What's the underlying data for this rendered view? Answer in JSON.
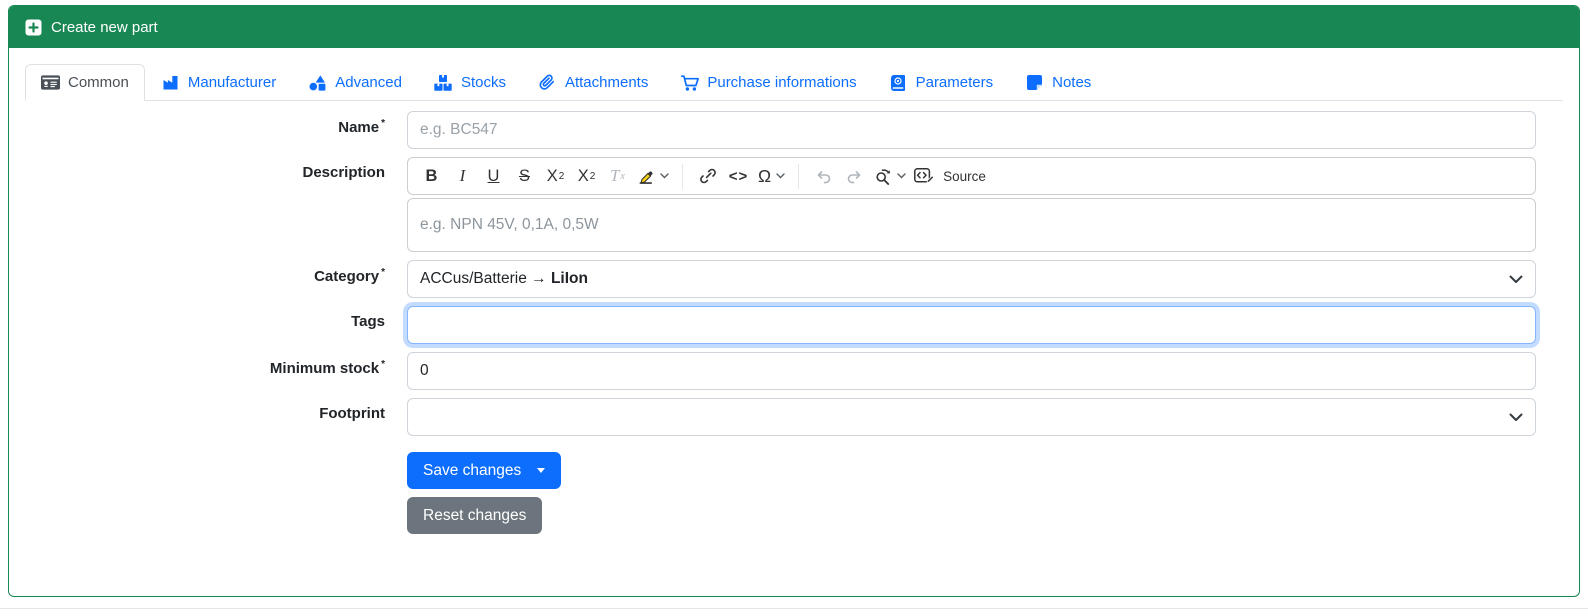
{
  "header": {
    "title": "Create new part"
  },
  "tabs": [
    {
      "label": "Common",
      "active": true
    },
    {
      "label": "Manufacturer"
    },
    {
      "label": "Advanced"
    },
    {
      "label": "Stocks"
    },
    {
      "label": "Attachments"
    },
    {
      "label": "Purchase informations"
    },
    {
      "label": "Parameters"
    },
    {
      "label": "Notes"
    }
  ],
  "form": {
    "name": {
      "label": "Name",
      "required": "*",
      "placeholder": "e.g. BC547",
      "value": ""
    },
    "description": {
      "label": "Description",
      "placeholder": "e.g. NPN 45V, 0,1A, 0,5W"
    },
    "category": {
      "label": "Category",
      "required": "*",
      "value_prefix": "ACCus/Batterie → ",
      "value_selected": "LiIon"
    },
    "tags": {
      "label": "Tags",
      "value": ""
    },
    "minimum_stock": {
      "label": "Minimum stock",
      "required": "*",
      "value": "0"
    },
    "footprint": {
      "label": "Footprint",
      "value": ""
    }
  },
  "editor_toolbar": {
    "bold": "B",
    "italic": "I",
    "underline": "U",
    "strikethrough": "S",
    "subscript_base": "X",
    "subscript_small": "2",
    "superscript_base": "X",
    "superscript_small": "2",
    "remove_format_base": "T",
    "remove_format_small": "x",
    "code": "<>",
    "special_char": "Ω",
    "source_label": "Source"
  },
  "buttons": {
    "save": "Save changes",
    "reset": "Reset changes"
  },
  "colors": {
    "header_green": "#198754",
    "link_blue": "#0d6efd",
    "save_blue": "#0d6efd",
    "reset_gray": "#6c757d",
    "focus_ring": "#86b7fe",
    "border": "#ced4da"
  }
}
